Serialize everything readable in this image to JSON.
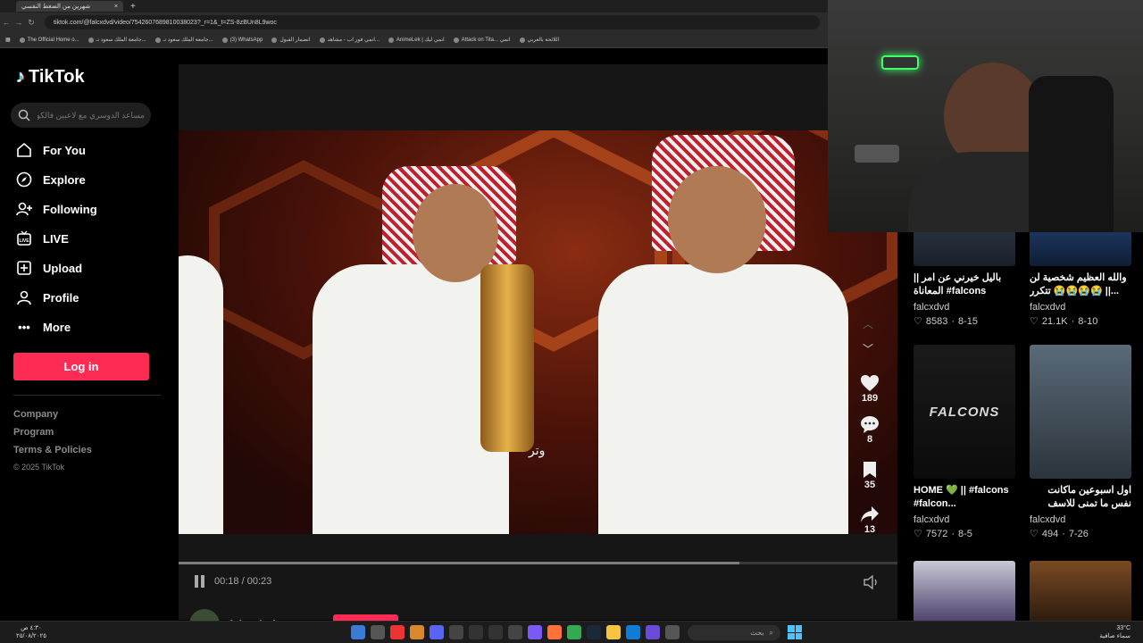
{
  "browser": {
    "tab_title": "شهرين من الضغط النفسي",
    "url": "tiktok.com/@falcxdvd/video/7542607689810038023?_r=1&_t=ZS-8zBUn8L9woc",
    "bookmarks": [
      "The Official Home o...",
      "جامعة الملك سعود تـ...",
      "جامعة الملك سعود تـ...",
      "(3) WhatsApp",
      "انضمار القبول",
      "انمي فور اب - مشاهد...",
      "AnimeLek | انمي ليك",
      "Attack on Tita... انمي",
      "اللائحة بالعربي"
    ]
  },
  "sidebar": {
    "logo_text": "TikTok",
    "search_placeholder": "مساعد الدوسري مع لاعبين فالكونز",
    "nav": [
      {
        "label": "For You",
        "icon": "home-icon"
      },
      {
        "label": "Explore",
        "icon": "compass-icon"
      },
      {
        "label": "Following",
        "icon": "following-icon"
      },
      {
        "label": "LIVE",
        "icon": "live-icon"
      },
      {
        "label": "Upload",
        "icon": "upload-icon"
      },
      {
        "label": "Profile",
        "icon": "profile-icon"
      },
      {
        "label": "More",
        "icon": "more-icon"
      }
    ],
    "login_label": "Log in",
    "footer": [
      "Company",
      "Program",
      "Terms & Policies"
    ],
    "copyright": "© 2025 TikTok"
  },
  "video": {
    "caption_overlay": "وتر",
    "time_current": "00:18",
    "time_total": "00:23",
    "progress": 0.78,
    "likes": "189",
    "comments": "8",
    "saves": "35",
    "shares": "13",
    "author": "falcxdvd"
  },
  "grid": [
    {
      "title": "|| باليل خيرني عن امر المعاناة #falcons #falcon...",
      "user": "falcxdvd",
      "likes": "8583",
      "date": "8-15"
    },
    {
      "title": "والله العظيم شخصية لن تتكرر 😭😭😭😭 ||...",
      "user": "falcxdvd",
      "likes": "21.1K",
      "date": "8-10"
    },
    {
      "title": "HOME 💚 || #falcons #falcon...",
      "user": "falcxdvd",
      "likes": "7572",
      "date": "8-5",
      "thumb_text": "FALCONS"
    },
    {
      "title": "اول اسبوعين ماكانت نفس ما تمنى للاسف يارب عوضنا",
      "user": "falcxdvd",
      "likes": "494",
      "date": "7-26"
    }
  ],
  "taskbar": {
    "search_label": "بحث",
    "time": "٤:٣٠ ص",
    "date": "٢٥/٠٨/٢٠٢٥",
    "temp": "33°C",
    "weather": "سماء صافية"
  },
  "colors": {
    "accent": "#fe2c55",
    "background": "#000000"
  }
}
